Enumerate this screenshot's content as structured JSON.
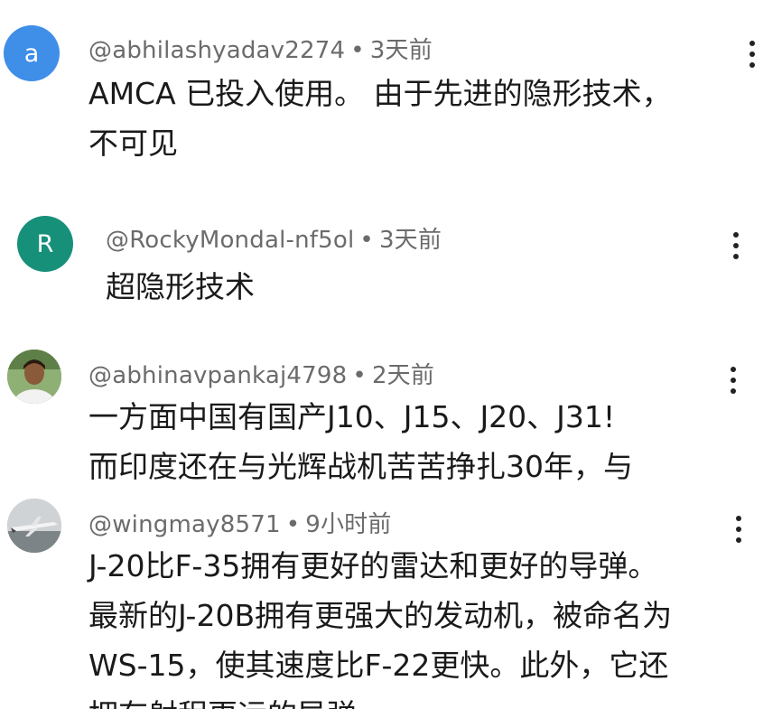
{
  "comments": [
    {
      "avatar_letter": "a",
      "avatar_color": "#3f8ee8",
      "author": "@abhilashyadav2274",
      "time": "3天前",
      "lines": [
        "AMCA 已投入使用。 由于先进的隐形技术，",
        "不可见"
      ]
    },
    {
      "avatar_letter": "R",
      "avatar_color": "#17907a",
      "author": "@RockyMondal-nf5ol",
      "time": "3天前",
      "lines": [
        "超隐形技术"
      ]
    },
    {
      "author": "@abhinavpankaj4798",
      "time": "2天前",
      "lines": [
        "一方面中国有国产J10、J15、J20、J31!",
        "而印度还在与光辉战机苦苦挣扎30年，与"
      ]
    },
    {
      "author": "@wingmay8571",
      "time": "9小时前",
      "lines": [
        "J-20比F-35拥有更好的雷达和更好的导弹。",
        "最新的J-20B拥有更强大的发动机，被命名为",
        "WS-15，使其速度比F-22更快。此外，它还",
        "拥有射程更远的导弹。"
      ]
    }
  ],
  "separator": "•"
}
